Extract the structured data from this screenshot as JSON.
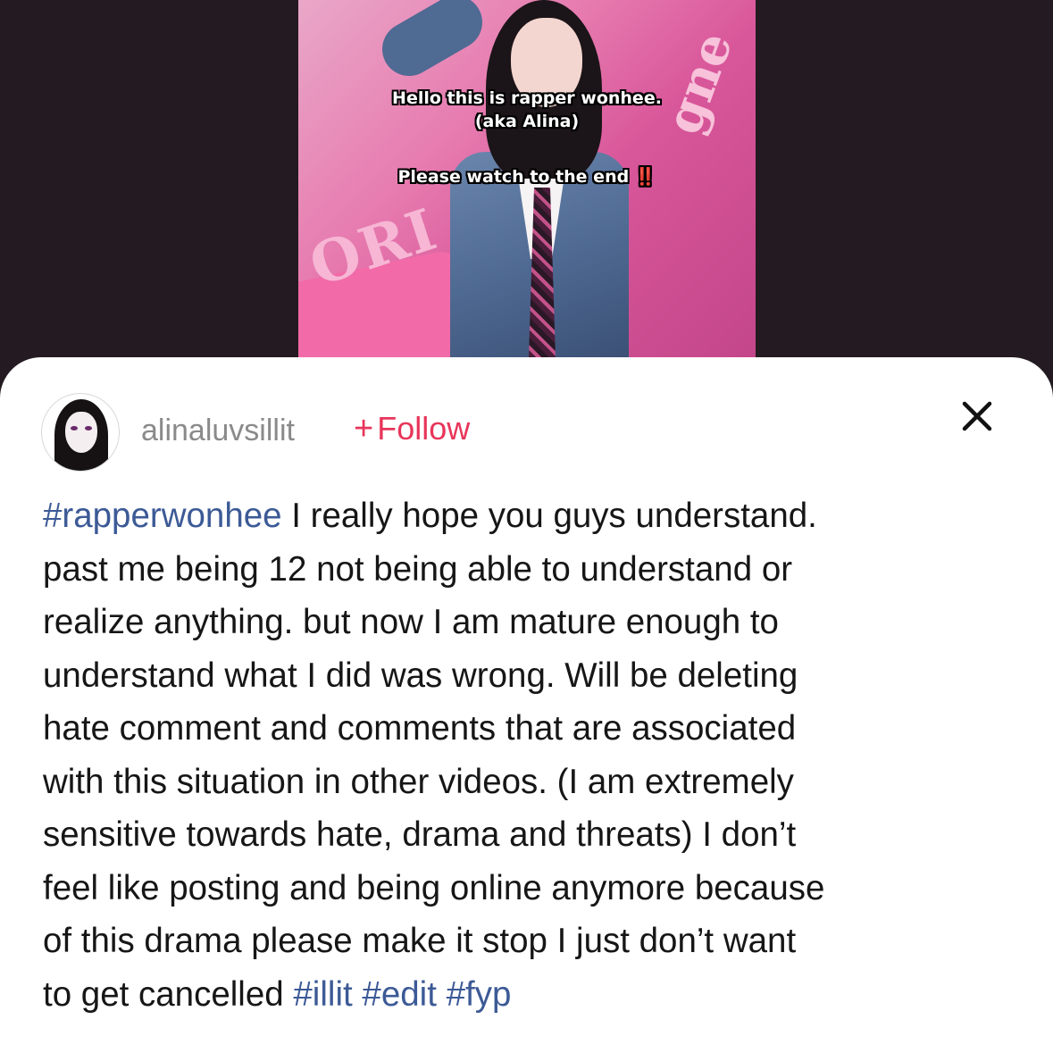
{
  "video": {
    "caption_line1": "Hello this is rapper wonhee.",
    "caption_line2": "(aka Alina)",
    "caption_line3": "Please watch to the end ",
    "caption_emoji": "‼️"
  },
  "post": {
    "username": "alinaluvsillit",
    "follow_label": "Follow",
    "follow_plus": "+",
    "description": {
      "line1_tag": "#rapperwonhee",
      "line1_text": " I really hope you guys understand.",
      "line2": "past me being 12 not being able to understand or",
      "line3": "realize anything. but now I am mature enough to",
      "line4": "understand what I did was wrong. Will be deleting",
      "line5": "hate comment and comments that are associated",
      "line6": "with this situation in other videos. (I am extremely",
      "line7": "sensitive towards hate, drama and threats) I don’t",
      "line8": "feel like posting and being online anymore because",
      "line9": "of this drama please make it stop I just don’t want",
      "line10_text": "to get cancelled ",
      "hashtags": [
        "#illit",
        "#edit",
        "#fyp"
      ]
    }
  },
  "icons": {
    "close": "close-icon",
    "avatar": "avatar"
  },
  "colors": {
    "follow": "#e8355a",
    "hashtag": "#3c5a96",
    "backdrop": "#231b21",
    "username": "#8a8a8a"
  }
}
